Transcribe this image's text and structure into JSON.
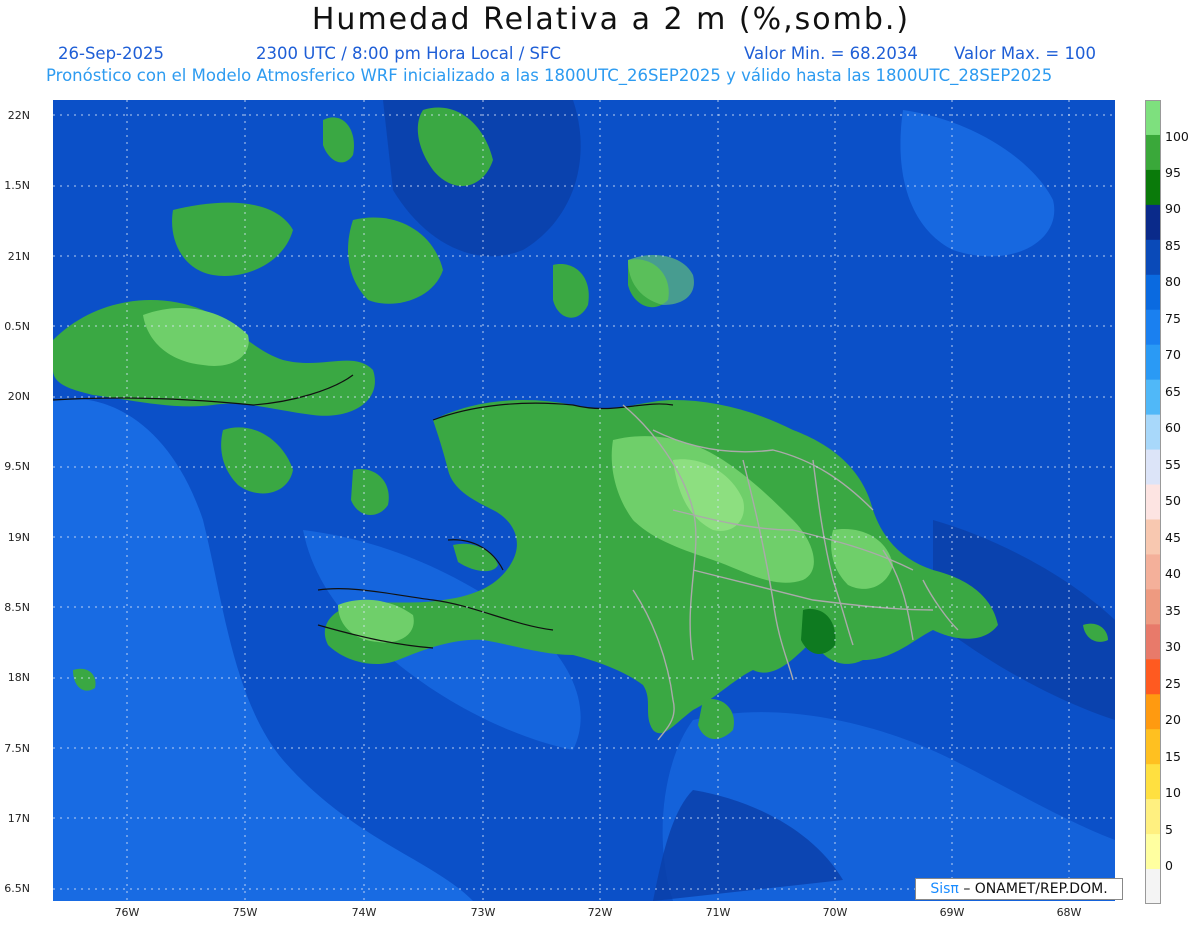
{
  "header": {
    "title": "Humedad Relativa a 2 m (%,somb.)",
    "date": "26-Sep-2025",
    "time_line": "2300 UTC / 8:00 pm Hora Local / SFC",
    "min_label": "Valor Min. = 68.2034",
    "max_label": "Valor Max. = 100",
    "model_line": "Pronóstico con el Modelo Atmosferico WRF inicializado a las 1800UTC_26SEP2025 y válido hasta las  1800UTC_28SEP2025"
  },
  "axes": {
    "lat_labels": [
      "22N",
      "1.5N",
      "21N",
      "0.5N",
      "20N",
      "9.5N",
      "19N",
      "8.5N",
      "18N",
      "7.5N",
      "17N",
      "6.5N"
    ],
    "lon_labels": [
      "76W",
      "75W",
      "74W",
      "73W",
      "72W",
      "71W",
      "70W",
      "69W",
      "68W"
    ]
  },
  "colorbar": {
    "labels": [
      "100",
      "95",
      "90",
      "85",
      "80",
      "75",
      "70",
      "65",
      "60",
      "55",
      "50",
      "45",
      "40",
      "35",
      "30",
      "25",
      "20",
      "15",
      "10",
      "5",
      "0"
    ],
    "colors": [
      "#7ee07e",
      "#3aa83a",
      "#0a7a0a",
      "#0a2a8a",
      "#0a4ab8",
      "#0a6ae0",
      "#1a80f0",
      "#2a9af5",
      "#50b8f8",
      "#a8d8fa",
      "#dce4f8",
      "#fde4e2",
      "#f8c8b0",
      "#f4b09a",
      "#ee9a80",
      "#e87a6a",
      "#ff5a20",
      "#ff9a10",
      "#ffc020",
      "#ffe040",
      "#fff080",
      "#ffffa0",
      "#f4f4f4"
    ]
  },
  "credit": {
    "sis": "Sisπ",
    "rest": "– ONAMET/REP.DOM."
  },
  "map_colors": {
    "ocean_light": "#1a73e8",
    "ocean_mid": "#0b50c8",
    "ocean_dark": "#083aa0",
    "land_green": "#3aa843",
    "land_light": "#6fcf6a",
    "land_dark": "#0e7a20"
  }
}
